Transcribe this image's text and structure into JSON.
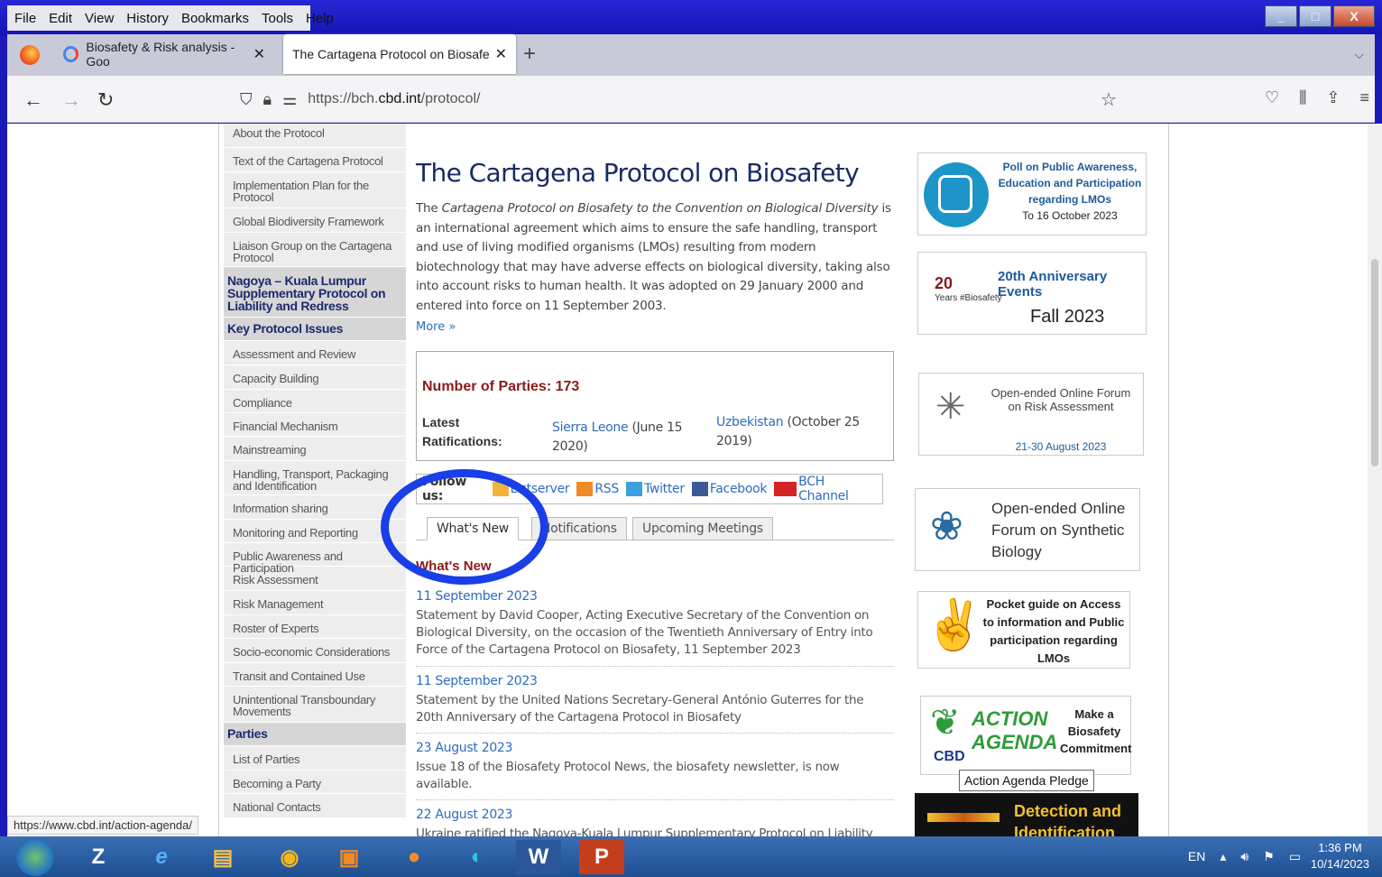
{
  "menu": [
    "File",
    "Edit",
    "View",
    "History",
    "Bookmarks",
    "Tools",
    "Help"
  ],
  "window_controls": [
    "_",
    "□",
    "X"
  ],
  "tabs": [
    {
      "title": "Biosafety & Risk analysis - Goo",
      "icon": "google-icon"
    },
    {
      "title": "The Cartagena Protocol on Biosafe",
      "icon": ""
    }
  ],
  "new_tab": "+",
  "url": {
    "prefix": "https://bch.",
    "host": "cbd.int",
    "path": "/protocol/"
  },
  "sidebar": {
    "items_top": [
      "About the Protocol",
      "Text of the Cartagena Protocol",
      "Implementation Plan for the Protocol",
      "Global Biodiversity Framework",
      "Liaison Group on the Cartagena Protocol"
    ],
    "nagoya": "Nagoya – Kuala Lumpur Supplementary Protocol on Liability and Redress",
    "key_head": "Key Protocol Issues",
    "key_items": [
      "Assessment and Review",
      "Capacity Building",
      "Compliance",
      "Financial Mechanism",
      "Mainstreaming",
      "Handling, Transport, Packaging and Identification",
      "Information sharing",
      "Monitoring and Reporting",
      "Public Awareness and Participation",
      "Risk Assessment",
      "Risk Management",
      "Roster of Experts",
      "Socio-economic Considerations",
      "Transit and Contained Use",
      "Unintentional Transboundary Movements"
    ],
    "parties_head": "Parties",
    "parties_items": [
      "List of Parties",
      "Becoming a Party",
      "National Contacts"
    ]
  },
  "main": {
    "title": "The Cartagena Protocol on Biosafety",
    "intro_a": "The ",
    "intro_em": "Cartagena Protocol on Biosafety to the Convention on Biological Diversity",
    "intro_b": " is an international agreement which aims to ensure the safe handling, transport and use of living modified organisms (LMOs) resulting from modern biotechnology that may have adverse effects on biological diversity, taking also into account risks to human health. It was adopted on 29 January 2000 and entered into force on 11 September 2003.",
    "more": "More »",
    "parties": "Number of Parties: 173",
    "ratifications_label": "Latest Ratifications:",
    "rat1_country": "Sierra Leone",
    "rat1_date": " (June 15 2020)",
    "rat2_country": "Uzbekistan",
    "rat2_date": " (October 25 2019)",
    "follow_label": "Follow us:",
    "follow": [
      "Listserver",
      "RSS",
      "Twitter",
      "Facebook",
      "BCH Channel"
    ],
    "page_tabs": [
      "What's New",
      "Notifications",
      "Upcoming Meetings"
    ],
    "whats_new_heading": "What's New",
    "news": [
      {
        "date": "11 September 2023",
        "text": "Statement by David Cooper, Acting Executive Secretary of the Convention on Biological Diversity, on the occasion of the Twentieth Anniversary of Entry into Force of the Cartagena Protocol on Biosafety, 11 September 2023"
      },
      {
        "date": "11 September 2023",
        "text": "Statement by the United Nations Secretary-General António Guterres for the 20th Anniversary of the Cartagena Protocol in Biosafety"
      },
      {
        "date": "23 August 2023",
        "text": "Issue 18 of the Biosafety Protocol News, the biosafety newsletter, is now available."
      },
      {
        "date": "22 August 2023",
        "text": "Ukraine ratified the Nagoya-Kuala Lumpur Supplementary Protocol on Liability"
      }
    ]
  },
  "banners": {
    "poll": {
      "line": "Poll on Public Awareness, Education and Participation regarding LMOs",
      "date": "To 16 October 2023"
    },
    "anniv": {
      "logo": "20",
      "logo_sub": "Years #Biosafety",
      "heading": "20th Anniversary Events",
      "when": "Fall 2023"
    },
    "forum": {
      "text": "Open-ended Online Forum on Risk Assessment",
      "date": "21-30 August 2023"
    },
    "synbio": {
      "text": "Open-ended Online Forum on Synthetic Biology"
    },
    "pocket": {
      "text": "Pocket guide on Access to information and Public participation regarding LMOs"
    },
    "agenda": {
      "cbd": "CBD",
      "action": "ACTION AGENDA",
      "text": "Make a Biosafety Commitment"
    },
    "tooltip": "Action Agenda Pledge",
    "detect": {
      "text": "Detection and Identification"
    }
  },
  "status_url": "https://www.cbd.int/action-agenda/",
  "taskbar": {
    "lang": "EN",
    "time": "1:36 PM",
    "date": "10/14/2023"
  }
}
